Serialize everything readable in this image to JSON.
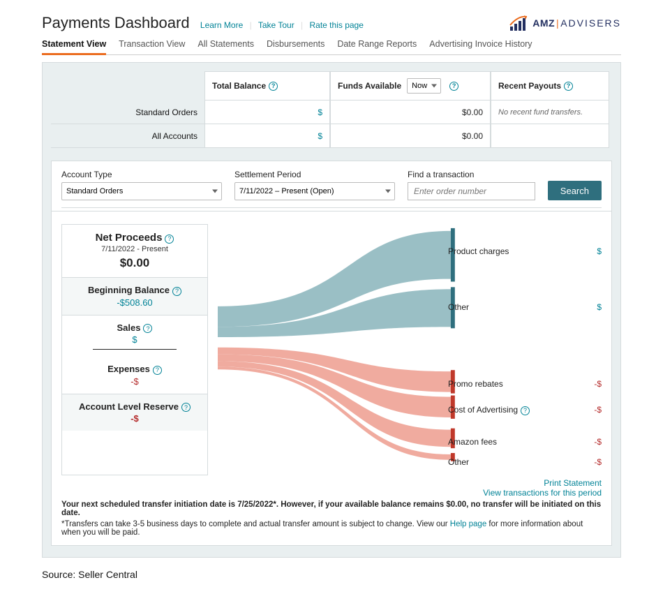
{
  "header": {
    "title": "Payments Dashboard",
    "links": {
      "learn": "Learn More",
      "tour": "Take Tour",
      "rate": "Rate this page"
    },
    "logo": {
      "brand1": "AMZ",
      "brand2": "ADVISERS"
    }
  },
  "tabs": {
    "statement": "Statement View",
    "transaction": "Transaction View",
    "all": "All Statements",
    "disb": "Disbursements",
    "drr": "Date Range Reports",
    "aih": "Advertising Invoice History"
  },
  "summary": {
    "row_labels": {
      "std": "Standard Orders",
      "all": "All Accounts"
    },
    "total_balance": {
      "label": "Total Balance",
      "std": "$",
      "all": "$"
    },
    "funds": {
      "label": "Funds Available",
      "selector": "Now",
      "std": "$0.00",
      "all": "$0.00"
    },
    "recent": {
      "label": "Recent Payouts",
      "text": "No recent fund transfers."
    }
  },
  "filters": {
    "account_type": {
      "label": "Account Type",
      "value": "Standard Orders"
    },
    "period": {
      "label": "Settlement Period",
      "value": "7/11/2022 – Present (Open)"
    },
    "find": {
      "label": "Find a transaction",
      "placeholder": "Enter order number"
    },
    "search": "Search"
  },
  "net_proceeds": {
    "title": "Net Proceeds",
    "subtitle": "7/11/2022 - Present",
    "amount": "$0.00",
    "begin": {
      "label": "Beginning Balance",
      "value": "-$508.60"
    },
    "sales": {
      "label": "Sales",
      "value": "$"
    },
    "expenses": {
      "label": "Expenses",
      "value": "-$"
    },
    "reserve": {
      "label": "Account Level Reserve",
      "value": "-$"
    }
  },
  "sankey": {
    "product_charges": {
      "label": "Product charges",
      "value": "$"
    },
    "other_in": {
      "label": "Other",
      "value": "$"
    },
    "promo": {
      "label": "Promo rebates",
      "value": "-$"
    },
    "coa": {
      "label": "Cost of Advertising",
      "value": "-$"
    },
    "fees": {
      "label": "Amazon fees",
      "value": "-$"
    },
    "other_out": {
      "label": "Other",
      "value": "-$"
    }
  },
  "footer": {
    "print": "Print Statement",
    "view_tx": "View transactions for this period",
    "note1a": "Your next scheduled transfer initiation date is 7/25/2022*. However, if your available balance remains $0.00, no transfer will be initiated on this date.",
    "note2a": "*Transfers can take 3-5 business days to complete and actual transfer amount is subject to change. View our ",
    "note2b": "Help page",
    "note2c": " for more information about when you will be paid."
  },
  "source": "Source: Seller Central"
}
